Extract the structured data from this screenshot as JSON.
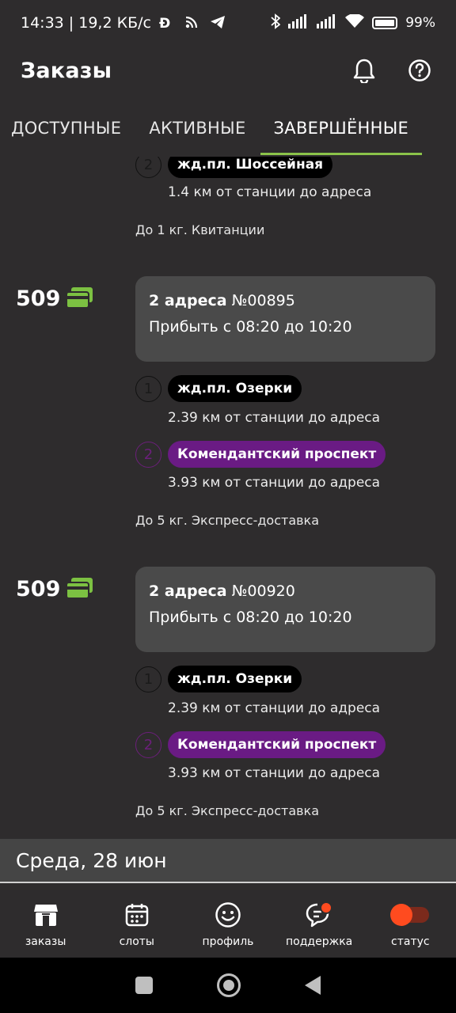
{
  "status_bar": {
    "left_text": "14:33 | 19,2 КБ/с",
    "battery": "99%",
    "icons": [
      "d-coin-icon",
      "rss-icon",
      "telegram-icon",
      "bluetooth-icon",
      "signal-icon",
      "signal-icon",
      "wifi-icon",
      "battery-icon"
    ]
  },
  "header": {
    "title": "Заказы",
    "icons": [
      "bell-icon",
      "help-icon"
    ]
  },
  "tabs": [
    {
      "label": "ДОСТУПНЫЕ",
      "active": false
    },
    {
      "label": "АКТИВНЫЕ",
      "active": false
    },
    {
      "label": "ЗАВЕРШЁННЫЕ",
      "active": true
    }
  ],
  "orders": [
    {
      "partial": true,
      "stops": [
        {
          "num": "2",
          "name": "жд.пл. Шоссейная",
          "distance": "1.4 км от станции до адреса",
          "color": "#000000"
        }
      ],
      "meta": "До 1 кг. Квитанции"
    },
    {
      "price": "509",
      "title_bold": "2 адреса",
      "number": "№00895",
      "time": "Прибыть с 08:20 до 10:20",
      "stops": [
        {
          "num": "1",
          "name": "жд.пл. Озерки",
          "distance": "2.39 км от станции до адреса",
          "color": "#000000"
        },
        {
          "num": "2",
          "name": "Комендантский проспект",
          "distance": "3.93 км от станции до адреса",
          "color": "#6a1b84"
        }
      ],
      "meta": "До 5 кг. Экспресс-доставка"
    },
    {
      "price": "509",
      "title_bold": "2 адреса",
      "number": "№00920",
      "time": "Прибыть с 08:20 до 10:20",
      "stops": [
        {
          "num": "1",
          "name": "жд.пл. Озерки",
          "distance": "2.39 км от станции до адреса",
          "color": "#000000"
        },
        {
          "num": "2",
          "name": "Комендантский проспект",
          "distance": "3.93 км от станции до адреса",
          "color": "#6a1b84"
        }
      ],
      "meta": "До 5 кг. Экспресс-доставка"
    }
  ],
  "day_header": "Среда, 28 июн",
  "bottom_nav": [
    {
      "label": "заказы",
      "icon": "shop-icon"
    },
    {
      "label": "слоты",
      "icon": "calendar-icon"
    },
    {
      "label": "профиль",
      "icon": "smile-icon"
    },
    {
      "label": "поддержка",
      "icon": "chat-icon"
    },
    {
      "label": "статус",
      "icon": "toggle-icon"
    }
  ],
  "colors": {
    "accent": "#8bc34a",
    "price_icon": "#7cc142",
    "purple": "#6a1b84",
    "toggle": "#ff4b1f"
  }
}
